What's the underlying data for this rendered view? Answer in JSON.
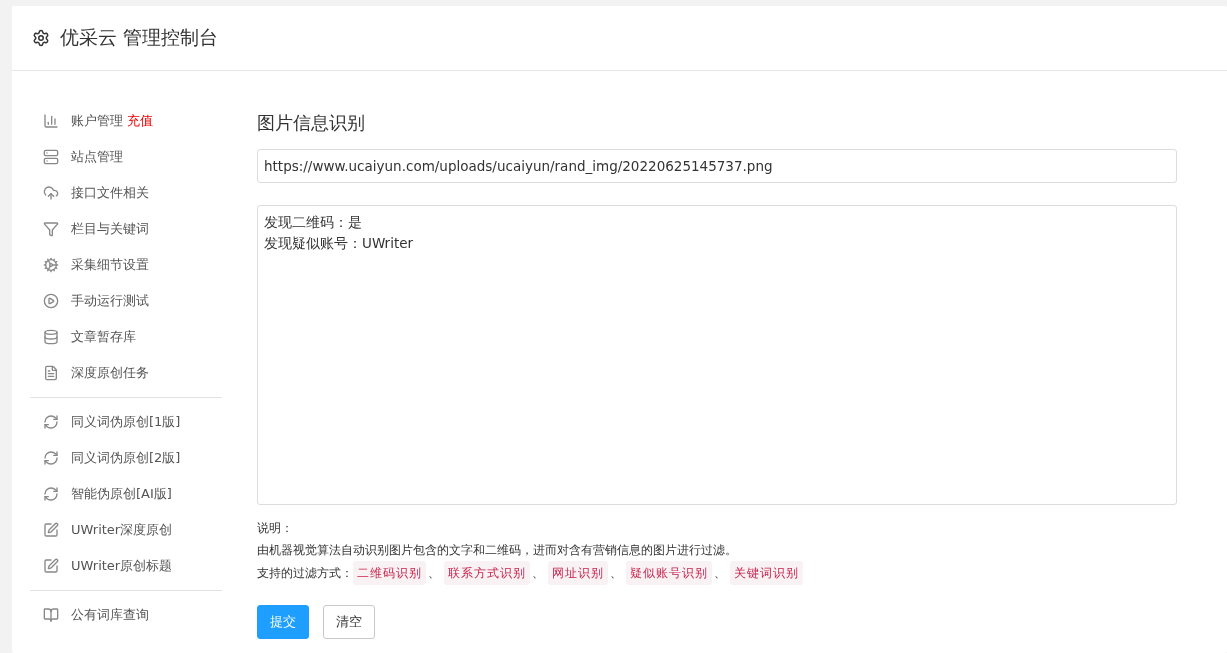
{
  "header": {
    "title": "优采云 管理控制台"
  },
  "sidebar": {
    "groups": [
      [
        {
          "kind": "chart",
          "label": "账户管理",
          "badge": "充值"
        },
        {
          "kind": "server",
          "label": "站点管理"
        },
        {
          "kind": "cloud",
          "label": "接口文件相关"
        },
        {
          "kind": "filter",
          "label": "栏目与关键词"
        },
        {
          "kind": "gears",
          "label": "采集细节设置"
        },
        {
          "kind": "play",
          "label": "手动运行测试"
        },
        {
          "kind": "database",
          "label": "文章暂存库"
        },
        {
          "kind": "doc",
          "label": "深度原创任务"
        }
      ],
      [
        {
          "kind": "refresh",
          "label": "同义词伪原创[1版]"
        },
        {
          "kind": "refresh",
          "label": "同义词伪原创[2版]"
        },
        {
          "kind": "refresh",
          "label": "智能伪原创[AI版]"
        },
        {
          "kind": "edit",
          "label": "UWriter深度原创"
        },
        {
          "kind": "edit",
          "label": "UWriter原创标题"
        }
      ],
      [
        {
          "kind": "book",
          "label": "公有词库查询"
        }
      ]
    ]
  },
  "main": {
    "title": "图片信息识别",
    "url_field": {
      "value": "https://www.ucaiyun.com/uploads/ucaiyun/rand_img/20220625145737.png"
    },
    "result_box": {
      "lines": [
        "发现二维码：是",
        "发现疑似账号：UWriter"
      ]
    },
    "note_title": "说明：",
    "note_text": "由机器视觉算法自动识别图片包含的文字和二维码，进而对含有营销信息的图片进行过滤。",
    "filters_label": "支持的过滤方式：",
    "filters": [
      "二维码识别",
      "联系方式识别",
      "网址识别",
      "疑似账号识别",
      "关键词识别"
    ],
    "separator": "、",
    "buttons": [
      {
        "kind": "primary",
        "label": "提交"
      },
      {
        "kind": "default",
        "label": "清空"
      }
    ]
  }
}
